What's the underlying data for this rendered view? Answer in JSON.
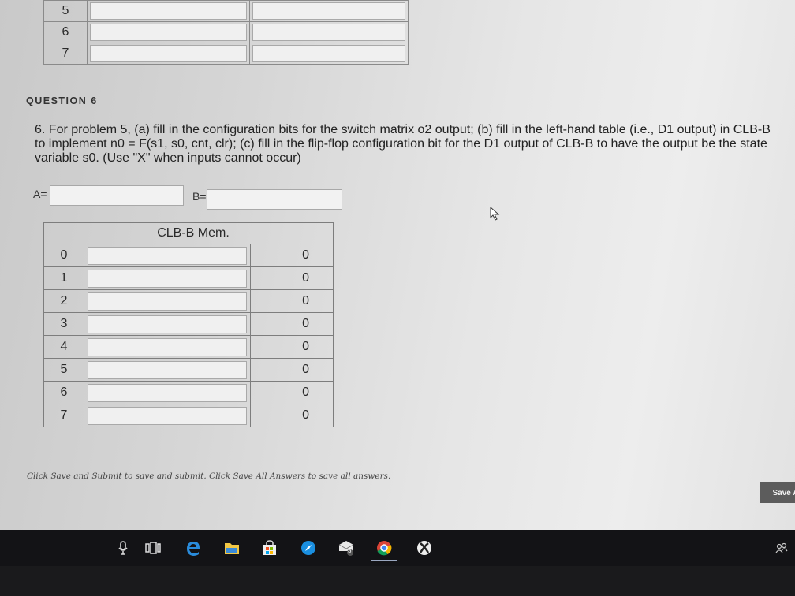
{
  "top_table": {
    "rows": [
      "5",
      "6",
      "7"
    ]
  },
  "question": {
    "label": "QUESTION 6",
    "text": "6. For problem 5, (a) fill in the configuration bits for the switch matrix o2 output; (b) fill in the left-hand table (i.e., D1 output) in CLB-B to implement n0 = F(s1, s0, cnt, clr); (c) fill in the flip-flop configuration bit for the D1 output of CLB-B to have the output be the state variable s0. (Use \"X\" when inputs cannot occur)"
  },
  "inputs": {
    "a_label": "A=",
    "a_value": "",
    "b_label": "B=",
    "b_value": ""
  },
  "clb_table": {
    "header": "CLB-B Mem.",
    "rows": [
      {
        "index": "0",
        "value": "0"
      },
      {
        "index": "1",
        "value": "0"
      },
      {
        "index": "2",
        "value": "0"
      },
      {
        "index": "3",
        "value": "0"
      },
      {
        "index": "4",
        "value": "0"
      },
      {
        "index": "5",
        "value": "0"
      },
      {
        "index": "6",
        "value": "0"
      },
      {
        "index": "7",
        "value": "0"
      }
    ]
  },
  "footer": {
    "note": "Click Save and Submit to save and submit. Click Save All Answers to save all answers.",
    "save_button": "Save A"
  },
  "taskbar": {
    "icons": [
      "microphone-icon",
      "task-view-icon",
      "edge-browser-icon",
      "file-explorer-icon",
      "store-icon",
      "safari-icon",
      "mail-icon",
      "chrome-icon",
      "xbox-icon",
      "people-icon"
    ],
    "mail_badge": "3"
  }
}
